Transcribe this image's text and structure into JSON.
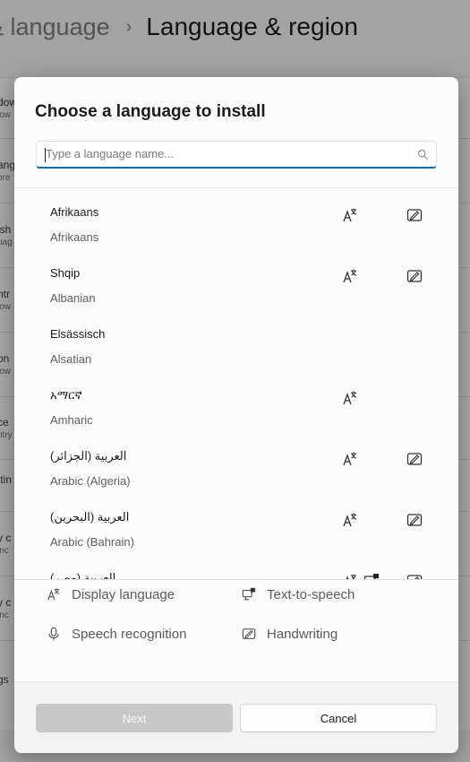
{
  "background": {
    "breadcrumb_parent": "& language",
    "breadcrumb_separator": "›",
    "title": "Language & region",
    "rows": [
      {
        "line1": "dow",
        "line2": "low"
      },
      {
        "line1": "ang",
        "line2": "ore"
      },
      {
        "line1": "ish",
        "line2": "uag"
      },
      {
        "line1": "ntr",
        "line2": "low"
      },
      {
        "line1": "on",
        "line2": "low"
      },
      {
        "line1": "ce",
        "line2": "ntry"
      },
      {
        "line1": "ttin",
        "line2": ""
      },
      {
        "line1": "y c",
        "line2": "inc"
      },
      {
        "line1": "y c",
        "line2": "inc"
      },
      {
        "line1": "gs",
        "line2": ""
      }
    ]
  },
  "dialog": {
    "title": "Choose a language to install",
    "search": {
      "placeholder": "Type a language name...",
      "value": ""
    },
    "languages": [
      {
        "native": "Afrikaans",
        "english": "Afrikaans",
        "features": [
          "display",
          "handwriting"
        ]
      },
      {
        "native": "Shqip",
        "english": "Albanian",
        "features": [
          "display",
          "handwriting"
        ]
      },
      {
        "native": "Elsässisch",
        "english": "Alsatian",
        "features": []
      },
      {
        "native": "አማርኛ",
        "english": "Amharic",
        "features": [
          "display"
        ]
      },
      {
        "native": "العربية (الجزائر)",
        "english": "Arabic (Algeria)",
        "features": [
          "display",
          "handwriting"
        ]
      },
      {
        "native": "العربية (البحرين)",
        "english": "Arabic (Bahrain)",
        "features": [
          "display",
          "handwriting"
        ]
      },
      {
        "native": "العربية (مصر)",
        "english": "",
        "features": [
          "display",
          "tts",
          "handwriting"
        ]
      }
    ],
    "legend": {
      "display": "Display language",
      "tts": "Text-to-speech",
      "speech": "Speech recognition",
      "handwriting": "Handwriting"
    },
    "buttons": {
      "next": "Next",
      "cancel": "Cancel"
    },
    "icons": {
      "display": "display-language-icon",
      "tts": "text-to-speech-icon",
      "speech": "microphone-icon",
      "handwriting": "handwriting-icon",
      "search": "search-icon"
    },
    "colors": {
      "accent": "#0f6cbd",
      "disabled_button": "#c8c8c8"
    }
  }
}
